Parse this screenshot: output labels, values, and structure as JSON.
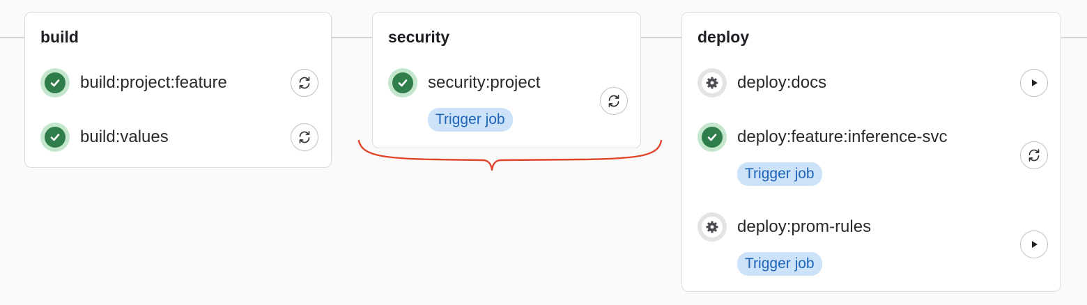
{
  "colors": {
    "success": "#2f7d4a",
    "manual": "#4a4a50",
    "badge_bg": "#cbe2f9",
    "badge_text": "#1f64b8",
    "brace": "#e0442a"
  },
  "stages": [
    {
      "title": "build",
      "jobs": [
        {
          "name": "build:project:feature",
          "status": "success",
          "status_icon": "check-circle-icon",
          "action_icon": "retry-icon"
        },
        {
          "name": "build:values",
          "status": "success",
          "status_icon": "check-circle-icon",
          "action_icon": "retry-icon"
        }
      ]
    },
    {
      "title": "security",
      "jobs": [
        {
          "name": "security:project",
          "status": "success",
          "badge": "Trigger job",
          "status_icon": "check-circle-icon",
          "action_icon": "retry-icon"
        }
      ]
    },
    {
      "title": "deploy",
      "jobs": [
        {
          "name": "deploy:docs",
          "status": "manual",
          "status_icon": "gear-icon",
          "action_icon": "play-icon"
        },
        {
          "name": "deploy:feature:inference-svc",
          "status": "success",
          "badge": "Trigger job",
          "status_icon": "check-circle-icon",
          "action_icon": "retry-icon"
        },
        {
          "name": "deploy:prom-rules",
          "status": "manual",
          "badge": "Trigger job",
          "status_icon": "gear-icon",
          "action_icon": "play-icon"
        }
      ]
    }
  ]
}
